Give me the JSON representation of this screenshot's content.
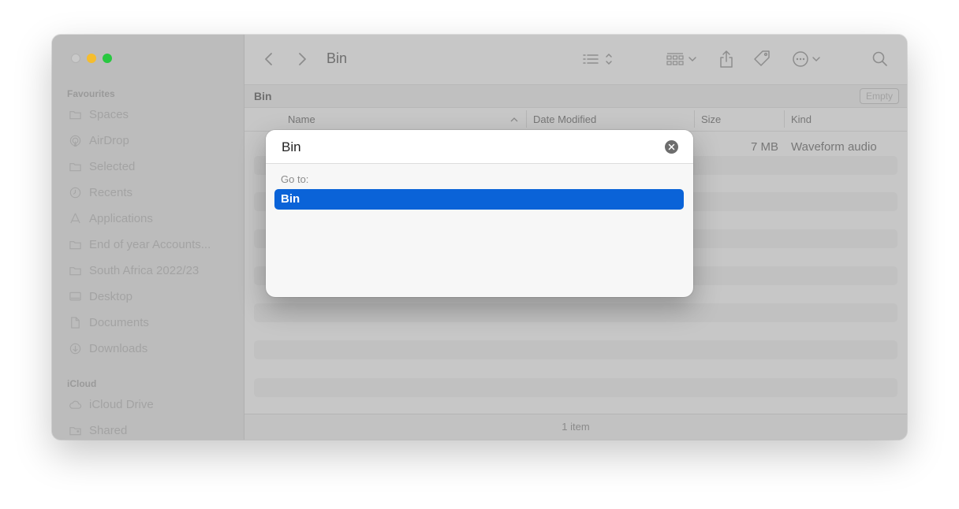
{
  "window": {
    "title": "Bin"
  },
  "sidebar": {
    "favourites_heading": "Favourites",
    "favourites": [
      {
        "label": "Spaces",
        "icon": "folder-icon"
      },
      {
        "label": "AirDrop",
        "icon": "airdrop-icon"
      },
      {
        "label": "Selected",
        "icon": "folder-icon"
      },
      {
        "label": "Recents",
        "icon": "clock-icon"
      },
      {
        "label": "Applications",
        "icon": "applications-icon"
      },
      {
        "label": "End of year Accounts...",
        "icon": "folder-icon"
      },
      {
        "label": "South Africa 2022/23",
        "icon": "folder-icon"
      },
      {
        "label": "Desktop",
        "icon": "desktop-icon"
      },
      {
        "label": "Documents",
        "icon": "document-icon"
      },
      {
        "label": "Downloads",
        "icon": "download-icon"
      }
    ],
    "icloud_heading": "iCloud",
    "icloud": [
      {
        "label": "iCloud Drive",
        "icon": "cloud-icon"
      },
      {
        "label": "Shared",
        "icon": "shared-folder-icon"
      }
    ]
  },
  "pathbar": {
    "label": "Bin",
    "empty_button": "Empty"
  },
  "columns": {
    "name": "Name",
    "date_modified": "Date Modified",
    "size": "Size",
    "kind": "Kind"
  },
  "file_row": {
    "size": "7 MB",
    "kind": "Waveform audio"
  },
  "status": {
    "item_count": "1 item"
  },
  "goto_dialog": {
    "input_value": "Bin",
    "section_label": "Go to:",
    "suggestions": [
      "Bin"
    ]
  },
  "colors": {
    "selection": "#0a63d8",
    "traffic_min": "#f5bd2e",
    "traffic_max": "#28c840"
  }
}
